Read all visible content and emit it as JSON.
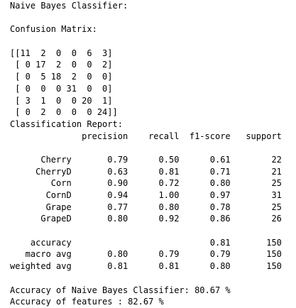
{
  "output_lines": [
    "Naive Bayes Classifier:",
    "",
    "Confusion Matrix:",
    "",
    "[[11  2  0  0  6  3]",
    " [ 0 17  2  0  0  2]",
    " [ 0  5 18  2  0  0]",
    " [ 0  0  0 31  0  0]",
    " [ 3  1  0  0 20  1]",
    " [ 0  2  0  0  0 24]]",
    "Classification Report:",
    "              precision    recall  f1-score   support",
    "",
    "      Cherry       0.79      0.50      0.61        22",
    "     CherryD       0.63      0.81      0.71        21",
    "        Corn       0.90      0.72      0.80        25",
    "       CornD       0.94      1.00      0.97        31",
    "       Grape       0.77      0.80      0.78        25",
    "      GrapeD       0.80      0.92      0.86        26",
    "",
    "    accuracy                           0.81       150",
    "   macro avg       0.80      0.79      0.79       150",
    "weighted avg       0.81      0.81      0.80       150",
    "",
    "Accuracy of Naive Bayes Classifier: 80.67 %",
    "Accuracy of features : 82.67 %"
  ]
}
